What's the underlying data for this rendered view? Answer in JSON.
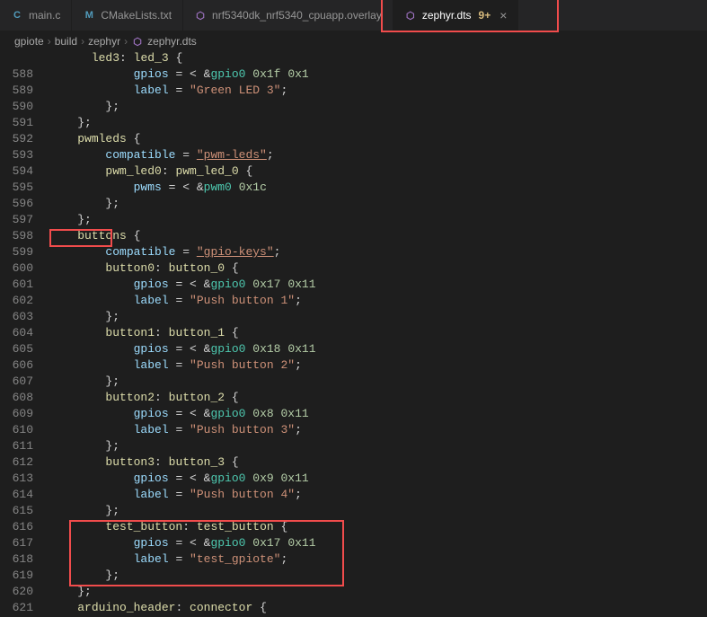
{
  "tabs": [
    {
      "icon": "C",
      "label": "main.c"
    },
    {
      "icon": "M",
      "label": "CMakeLists.txt"
    },
    {
      "icon": "⬡",
      "label": "nrf5340dk_nrf5340_cpuapp.overlay"
    },
    {
      "icon": "⬡",
      "label": "zephyr.dts",
      "diff": "9+",
      "active": true
    }
  ],
  "breadcrumb": {
    "p1": "gpiote",
    "p2": "build",
    "p3": "zephyr",
    "p4": "zephyr.dts"
  },
  "lines": [
    {
      "n": "",
      "t": "<g|      ><n|led3><p|: ><n|led_3><p| {>"
    },
    {
      "n": "588",
      "t": "<g|            ><k|gpios><p| = < &><r|gpio0><p| ><m|0x1f><p| ><m|0x1><p| >;>"
    },
    {
      "n": "589",
      "t": "<g|            ><k|label><p| = ><s2|\"Green LED 3\"><p|;>"
    },
    {
      "n": "590",
      "t": "<g|        ><p|};>"
    },
    {
      "n": "591",
      "t": "<g|    ><p|};>"
    },
    {
      "n": "592",
      "t": "<g|    ><n|pwmleds><p| {>"
    },
    {
      "n": "593",
      "t": "<g|        ><k|compatible><p| = ><s|\"pwm-leds\"><p|;>"
    },
    {
      "n": "594",
      "t": "<g|        ><n|pwm_led0><p|: ><n|pwm_led_0><p| {>"
    },
    {
      "n": "595",
      "t": "<g|            ><k|pwms><p| = < &><r|pwm0><p| ><m|0x1c><p| >;>"
    },
    {
      "n": "596",
      "t": "<g|        ><p|};>"
    },
    {
      "n": "597",
      "t": "<g|    ><p|};>"
    },
    {
      "n": "598",
      "t": "<g|    ><n|buttons><p| {>"
    },
    {
      "n": "599",
      "t": "<g|        ><k|compatible><p| = ><s|\"gpio-keys\"><p|;>"
    },
    {
      "n": "600",
      "t": "<g|        ><n|button0><p|: ><n|button_0><p| {>"
    },
    {
      "n": "601",
      "t": "<g|            ><k|gpios><p| = < &><r|gpio0><p| ><m|0x17><p| ><m|0x11><p| >;>"
    },
    {
      "n": "602",
      "t": "<g|            ><k|label><p| = ><s2|\"Push button 1\"><p|;>"
    },
    {
      "n": "603",
      "t": "<g|        ><p|};>"
    },
    {
      "n": "604",
      "t": "<g|        ><n|button1><p|: ><n|button_1><p| {>"
    },
    {
      "n": "605",
      "t": "<g|            ><k|gpios><p| = < &><r|gpio0><p| ><m|0x18><p| ><m|0x11><p| >;>"
    },
    {
      "n": "606",
      "t": "<g|            ><k|label><p| = ><s2|\"Push button 2\"><p|;>"
    },
    {
      "n": "607",
      "t": "<g|        ><p|};>"
    },
    {
      "n": "608",
      "t": "<g|        ><n|button2><p|: ><n|button_2><p| {>"
    },
    {
      "n": "609",
      "t": "<g|            ><k|gpios><p| = < &><r|gpio0><p| ><m|0x8><p| ><m|0x11><p| >;>"
    },
    {
      "n": "610",
      "t": "<g|            ><k|label><p| = ><s2|\"Push button 3\"><p|;>"
    },
    {
      "n": "611",
      "t": "<g|        ><p|};>"
    },
    {
      "n": "612",
      "t": "<g|        ><n|button3><p|: ><n|button_3><p| {>"
    },
    {
      "n": "613",
      "t": "<g|            ><k|gpios><p| = < &><r|gpio0><p| ><m|0x9><p| ><m|0x11><p| >;>"
    },
    {
      "n": "614",
      "t": "<g|            ><k|label><p| = ><s2|\"Push button 4\"><p|;>"
    },
    {
      "n": "615",
      "t": "<g|        ><p|};>"
    },
    {
      "n": "616",
      "t": "<g|        ><n|test_button><p|: ><n|test_button><p| {>"
    },
    {
      "n": "617",
      "t": "<g|            ><k|gpios><p| = < &><r|gpio0><p| ><m|0x17><p| ><m|0x11><p| >;>"
    },
    {
      "n": "618",
      "t": "<g|            ><k|label><p| = ><s2|\"test_gpiote\"><p|;>"
    },
    {
      "n": "619",
      "t": "<g|        ><p|};>"
    },
    {
      "n": "620",
      "t": "<g|    ><p|};>"
    },
    {
      "n": "621",
      "t": "<g|    ><n|arduino_header><p|: ><n|connector><p| {>"
    }
  ]
}
